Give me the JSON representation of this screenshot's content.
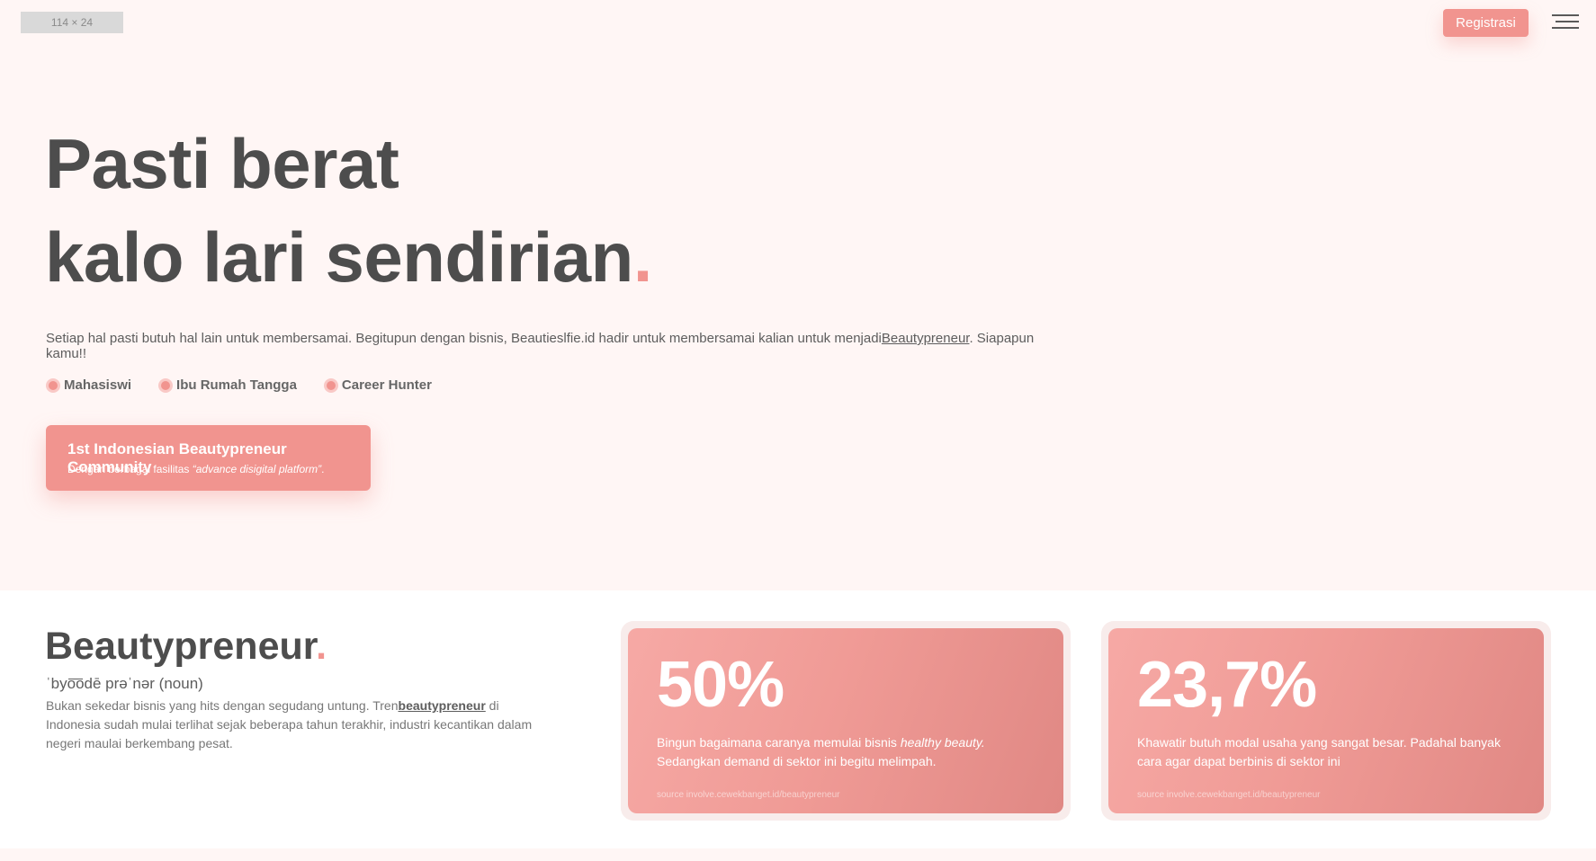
{
  "header": {
    "logo_placeholder": "114 × 24",
    "register_label": "Registrasi",
    "menu_icon": "hamburger-menu-icon"
  },
  "hero": {
    "title_line1": "Pasti berat",
    "title_line2": "kalo lari sendirian",
    "title_dot": ".",
    "desc_before": "Setiap hal pasti butuh hal lain untuk membersamai. Begitupun dengan bisnis, Beautieslfie.id hadir untuk membersamai kalian untuk menjadi",
    "desc_link": "Beautypreneur",
    "desc_after": ". Siapapun kamu!!",
    "audience": [
      "Mahasiswi",
      "Ibu Rumah Tangga",
      "Career Hunter"
    ],
    "cta_title": "1st Indonesian Beautypreneur Community",
    "cta_sub_before": "Dengan berbagai fasilitas ",
    "cta_sub_italic": "“advance disigital platform”",
    "cta_sub_after": "."
  },
  "beautypreneur": {
    "title": "Beautypreneur",
    "title_dot": ".",
    "phonetic": "ˈbyo͞odē prəˈnər (noun)",
    "desc_before": "Bukan sekedar bisnis yang hits dengan segudang untung. Tren",
    "desc_bold": "beautypreneur",
    "desc_after": " di Indonesia sudah mulai terlihat sejak beberapa tahun terakhir, industri kecantikan dalam negeri maulai berkembang pesat."
  },
  "stats": [
    {
      "value": "50%",
      "text_before": "Bingun bagaimana caranya memulai bisnis ",
      "text_italic": "healthy beauty.",
      "text_after": " Sedangkan demand di sektor ini begitu melimpah.",
      "source": "source involve.cewekbanget.id/beautypreneur"
    },
    {
      "value": "23,7%",
      "text_before": "Khawatir butuh modal usaha yang sangat besar. Padahal banyak cara agar dapat berbinis di sektor ini",
      "text_italic": "",
      "text_after": "",
      "source": "source involve.cewekbanget.id/beautypreneur"
    }
  ],
  "colors": {
    "accent": "#f1948f",
    "background": "#fff6f5",
    "heading": "#4d4d4d"
  }
}
